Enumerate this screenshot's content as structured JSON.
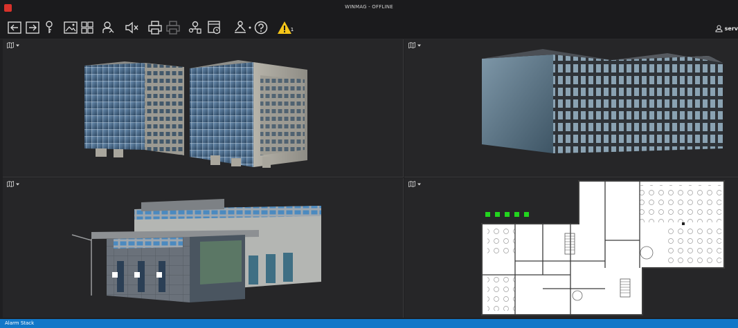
{
  "window": {
    "title": "WINMAG - OFFLINE"
  },
  "toolbar": {
    "buttons": [
      {
        "icon": "exit-icon"
      },
      {
        "icon": "enter-icon"
      },
      {
        "icon": "key-icon"
      },
      {
        "icon": "image-icon"
      },
      {
        "icon": "grid-icon"
      },
      {
        "icon": "user-sync-icon"
      },
      {
        "icon": "mute-icon"
      },
      {
        "icon": "print-icon"
      },
      {
        "icon": "print-disabled-icon"
      },
      {
        "icon": "users-icon"
      },
      {
        "icon": "clock-window-icon"
      },
      {
        "icon": "network-icon"
      },
      {
        "icon": "help-icon"
      },
      {
        "icon": "warning-icon"
      }
    ],
    "warning_count": "1"
  },
  "user": {
    "name": "serv"
  },
  "panels": [
    {
      "id": "top-left",
      "content": "3d-office-buildings"
    },
    {
      "id": "top-right",
      "content": "3d-l-shaped-building"
    },
    {
      "id": "bottom-left",
      "content": "3d-industrial-building"
    },
    {
      "id": "bottom-right",
      "content": "floor-plan"
    }
  ],
  "status": {
    "alarm_stack": "Alarm Stack"
  },
  "colors": {
    "statusbar": "#1177c8",
    "warning": "#f5c518",
    "brand": "#d8322b",
    "sensor_green": "#22d41e"
  }
}
